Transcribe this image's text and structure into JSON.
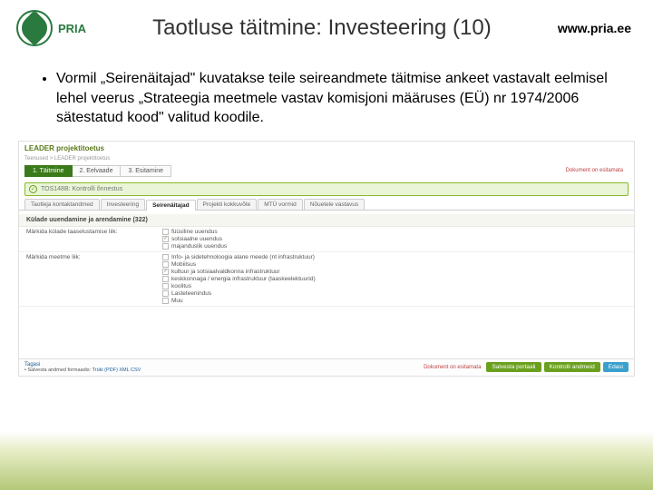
{
  "header": {
    "logo_text": "PRIA",
    "title": "Taotluse täitmine: Investeering (10)",
    "url": "www.pria.ee"
  },
  "bullet": "Vormil „Seirenäitajad\" kuvatakse teile seireandmete täitmise ankeet vastavalt eelmisel lehel veerus „Strateegia meetmele vastav komisjoni määruses (EÜ) nr 1974/2006 sätestatud kood\" valitud koodile.",
  "shot": {
    "title": "LEADER projektitoetus",
    "crumb": "Teenused > LEADER projektitoetus",
    "steps": [
      "1. Täitmine",
      "2. Eelvaade",
      "3. Esitamine"
    ],
    "doc_status": "Dokument on esitamata",
    "greenbar": "TOS148B: Kontrolli õnnestus",
    "tabs": [
      "Taotleja kontaktandmed",
      "Investeering",
      "Seirenäitajad",
      "Projekti kokkuvõte",
      "MTÜ vormid",
      "Nõuetele vastavus"
    ],
    "section_head": "Külade uuendamine ja arendamine (322)",
    "row1": {
      "label": "Märkida külade taaselustamise liik:",
      "opts": [
        "füüsiline uuendus",
        "sotsiaalne uuendus",
        "majanduslik uuendus"
      ]
    },
    "row2": {
      "label": "Märkida meetme liik:",
      "opts": [
        "Info- ja sidetehnoloogia alane meede (nt infrastruktuur)",
        "Mobiilsus",
        "kultuur ja sotsiaalvaldkonna infrastruktuur",
        "keskkonnaga / energia infrastruktuur (taaskeelektuurid)",
        "koolitus",
        "Lasteteenindus",
        "Muu"
      ]
    },
    "footer": {
      "back": "Tagasi",
      "save_label": "Salvesta andmed formaadis:",
      "formats": "Trüki (PDF)  XML  CSV",
      "save": "Salvesta portaali",
      "check": "Kontrolli andmeid",
      "next": "Edasi"
    }
  }
}
